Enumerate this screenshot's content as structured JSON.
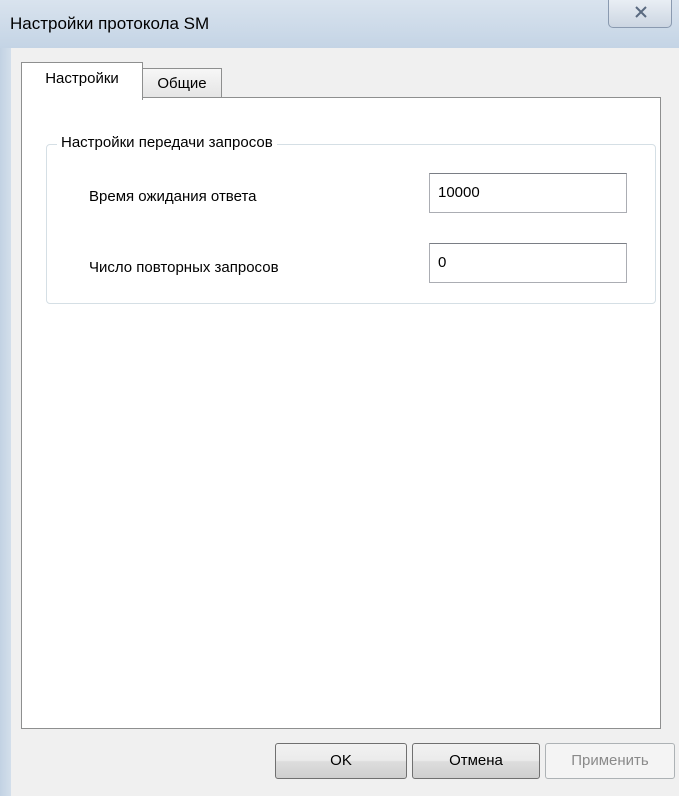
{
  "window": {
    "title": "Настройки протокола SM"
  },
  "tabs": [
    {
      "label": "Настройки",
      "active": true
    },
    {
      "label": "Общие",
      "active": false
    }
  ],
  "group": {
    "title": "Настройки передачи запросов",
    "fields": [
      {
        "label": "Время ожидания ответа",
        "value": "10000"
      },
      {
        "label": "Число повторных запросов",
        "value": "0"
      }
    ]
  },
  "buttons": {
    "ok": "OK",
    "cancel": "Отмена",
    "apply": "Применить"
  },
  "icons": {
    "close": "close-icon"
  }
}
